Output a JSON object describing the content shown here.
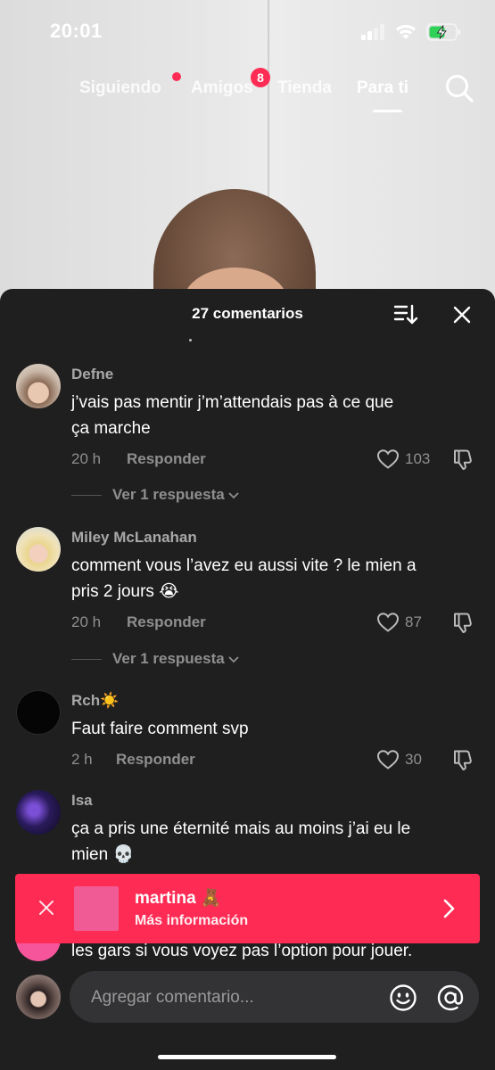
{
  "status_bar": {
    "time": "20:01",
    "battery_color": "#30d158"
  },
  "nav": {
    "tabs": [
      {
        "label": "Siguiendo",
        "active": false,
        "has_dot": true
      },
      {
        "label": "Amigos",
        "active": false,
        "badge": "8"
      },
      {
        "label": "Tienda",
        "active": false
      },
      {
        "label": "Para ti",
        "active": true
      }
    ],
    "accent_color": "#fe2c55"
  },
  "comments_panel": {
    "title": "27 comentarios",
    "comments": [
      {
        "user": "Defne",
        "text_line1": "j’vais pas mentir j’m’attendais pas à ce que",
        "text_line2": "ça marche",
        "time": "20 h",
        "reply_label": "Responder",
        "likes": "103",
        "replies_label": "Ver 1 respuesta"
      },
      {
        "user": "Miley McLanahan",
        "text_line1": "comment vous l’avez eu aussi vite ? le mien a",
        "text_line2": "pris 2 jours 😭",
        "time": "20 h",
        "reply_label": "Responder",
        "likes": "87",
        "replies_label": "Ver 1 respuesta"
      },
      {
        "user": "Rch☀️",
        "text_line1": "Faut faire comment svp",
        "time": "2 h",
        "reply_label": "Responder",
        "likes": "30"
      },
      {
        "user": "Isa",
        "text_line1": "ça a pris une éternité mais au moins j’ai eu le",
        "text_line2": "mien 💀"
      }
    ],
    "peek_text": "les gars si vous voyez pas l’option pour jouer."
  },
  "ad": {
    "title": "martina 🧸",
    "subtitle": "Más información",
    "color": "#fe2c55"
  },
  "input": {
    "placeholder": "Agregar comentario..."
  }
}
